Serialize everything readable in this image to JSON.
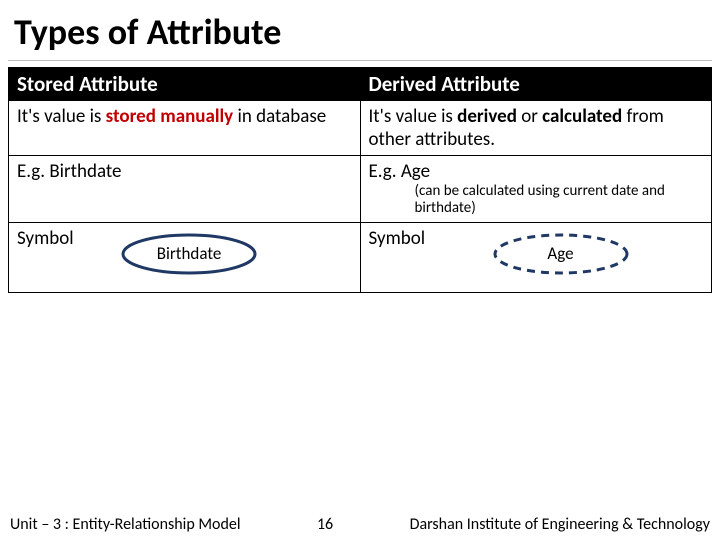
{
  "title": "Types of Attribute",
  "table": {
    "headers": {
      "left": "Stored Attribute",
      "right": "Derived Attribute"
    },
    "row1": {
      "left_pre": "It's value is ",
      "left_em": "stored manually",
      "left_post": " in database",
      "right_pre": "It's value is ",
      "right_em1": "derived",
      "right_mid": " or ",
      "right_em2": "calculated",
      "right_post": " from other attributes."
    },
    "row2": {
      "left": "E.g. Birthdate",
      "right": "E.g. Age",
      "right_note": "(can be calculated using current date and birthdate)"
    },
    "row3": {
      "label": "Symbol",
      "left_ellipse": "Birthdate",
      "right_ellipse": "Age"
    }
  },
  "footer": {
    "left": "Unit – 3 : Entity-Relationship Model",
    "page": "16",
    "right": "Darshan Institute of Engineering & Technology"
  },
  "colors": {
    "stroke": "#1f3864"
  }
}
